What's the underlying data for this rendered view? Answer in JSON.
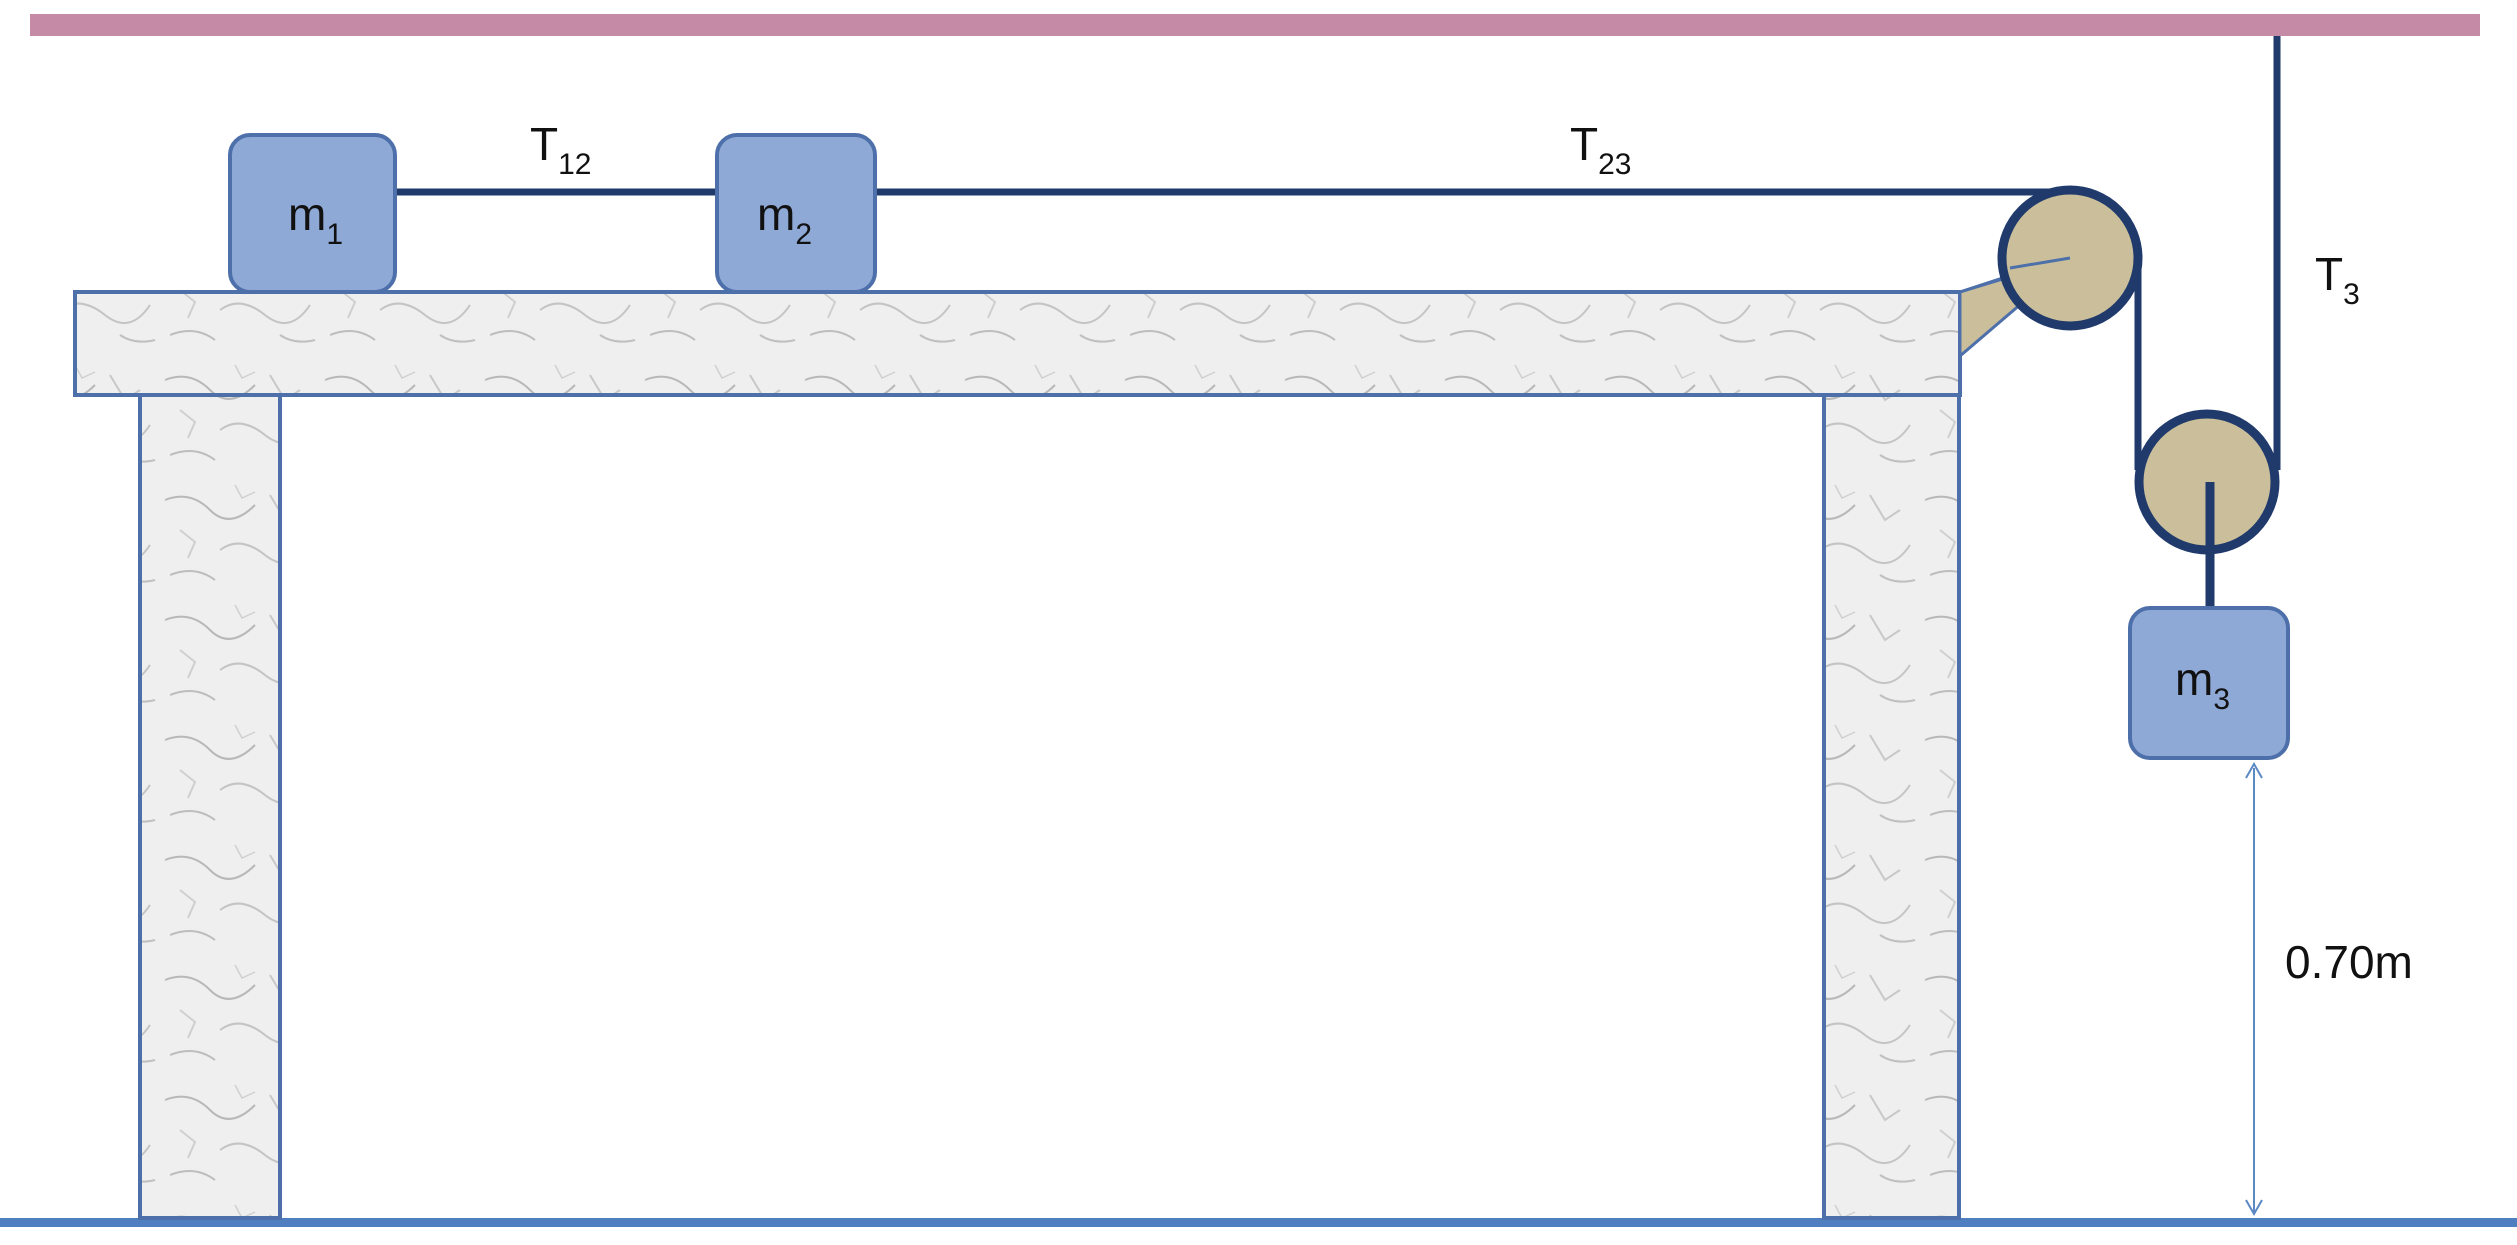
{
  "masses": {
    "m1": {
      "base": "m",
      "sub": "1"
    },
    "m2": {
      "base": "m",
      "sub": "2"
    },
    "m3": {
      "base": "m",
      "sub": "3"
    }
  },
  "tensions": {
    "t12": {
      "base": "T",
      "sub": "12"
    },
    "t23": {
      "base": "T",
      "sub": "23"
    },
    "t3": {
      "base": "T",
      "sub": "3"
    }
  },
  "dimension": {
    "height_label": "0.70m"
  },
  "colors": {
    "ceiling": "#c48aa6",
    "rope": "#1f3a6b",
    "block_fill": "#8fa9d6",
    "block_stroke": "#4d6faa",
    "pulley_fill": "#cbbf9b",
    "pulley_stroke": "#1f3a6b",
    "floor": "#4f7fc0",
    "marble_fill": "#eeeeee",
    "marble_stroke": "#4d6faa",
    "dimension_line": "#5b89c4"
  }
}
